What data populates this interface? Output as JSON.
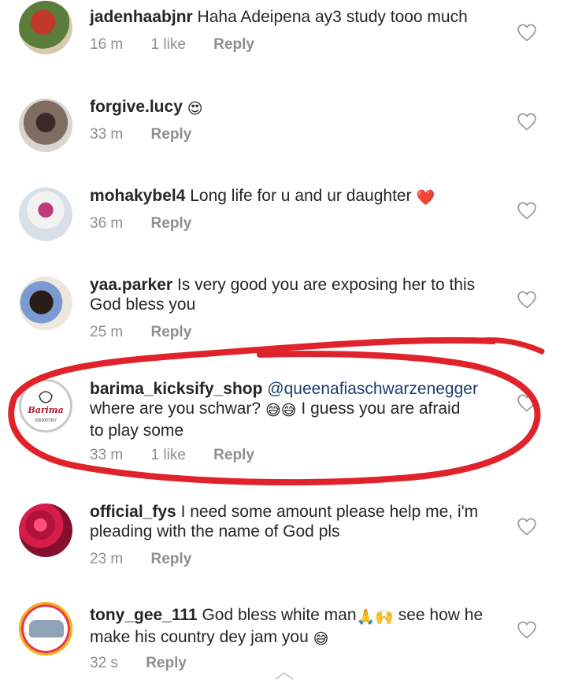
{
  "comments": [
    {
      "username": "jadenhaabjnr",
      "text": "Haha Adeipena ay3 study tooo much",
      "time": "16 m",
      "likes": "1 like",
      "reply": "Reply"
    },
    {
      "username": "forgive.lucy",
      "text": "",
      "emoji": "😍",
      "time": "33 m",
      "likes": "",
      "reply": "Reply"
    },
    {
      "username": "mohakybel4",
      "text": "Long life for u and ur daughter",
      "emoji": "❤️",
      "time": "36 m",
      "likes": "",
      "reply": "Reply"
    },
    {
      "username": "yaa.parker",
      "text_line1": "Is very good you are exposing her to this",
      "text_line2": "God bless you",
      "time": "25 m",
      "likes": "",
      "reply": "Reply"
    },
    {
      "username": "barima_kicksify_shop",
      "mention": "@queenafiaschwarzenegger",
      "text_line2a": "where are you schwar?",
      "emoji": "😅😅",
      "text_line2b": "I guess you are afraid",
      "text_line3": "to play some",
      "time": "33 m",
      "likes": "1 like",
      "reply": "Reply",
      "avatar_brand": "Barima",
      "avatar_phone": "0263007367"
    },
    {
      "username": "official_fys",
      "text_line1": "I need some amount please help me, i'm",
      "text_line2": "pleading with the name of God pls",
      "time": "23 m",
      "likes": "",
      "reply": "Reply"
    },
    {
      "username": "tony_gee_111",
      "text_line1a": "God bless white man",
      "emoji1": "🙏🙌",
      "text_line1b": "see how he",
      "text_line2": "make his country dey jam you",
      "emoji2": "😅",
      "time": "32 s",
      "likes": "",
      "reply": "Reply"
    }
  ],
  "colors": {
    "text": "#262626",
    "meta": "#8e8e8e",
    "mention": "#1a3e73",
    "annotation": "#e0232b"
  },
  "icons": {
    "like": "heart-outline-icon",
    "scroll": "chevron-up-icon"
  }
}
